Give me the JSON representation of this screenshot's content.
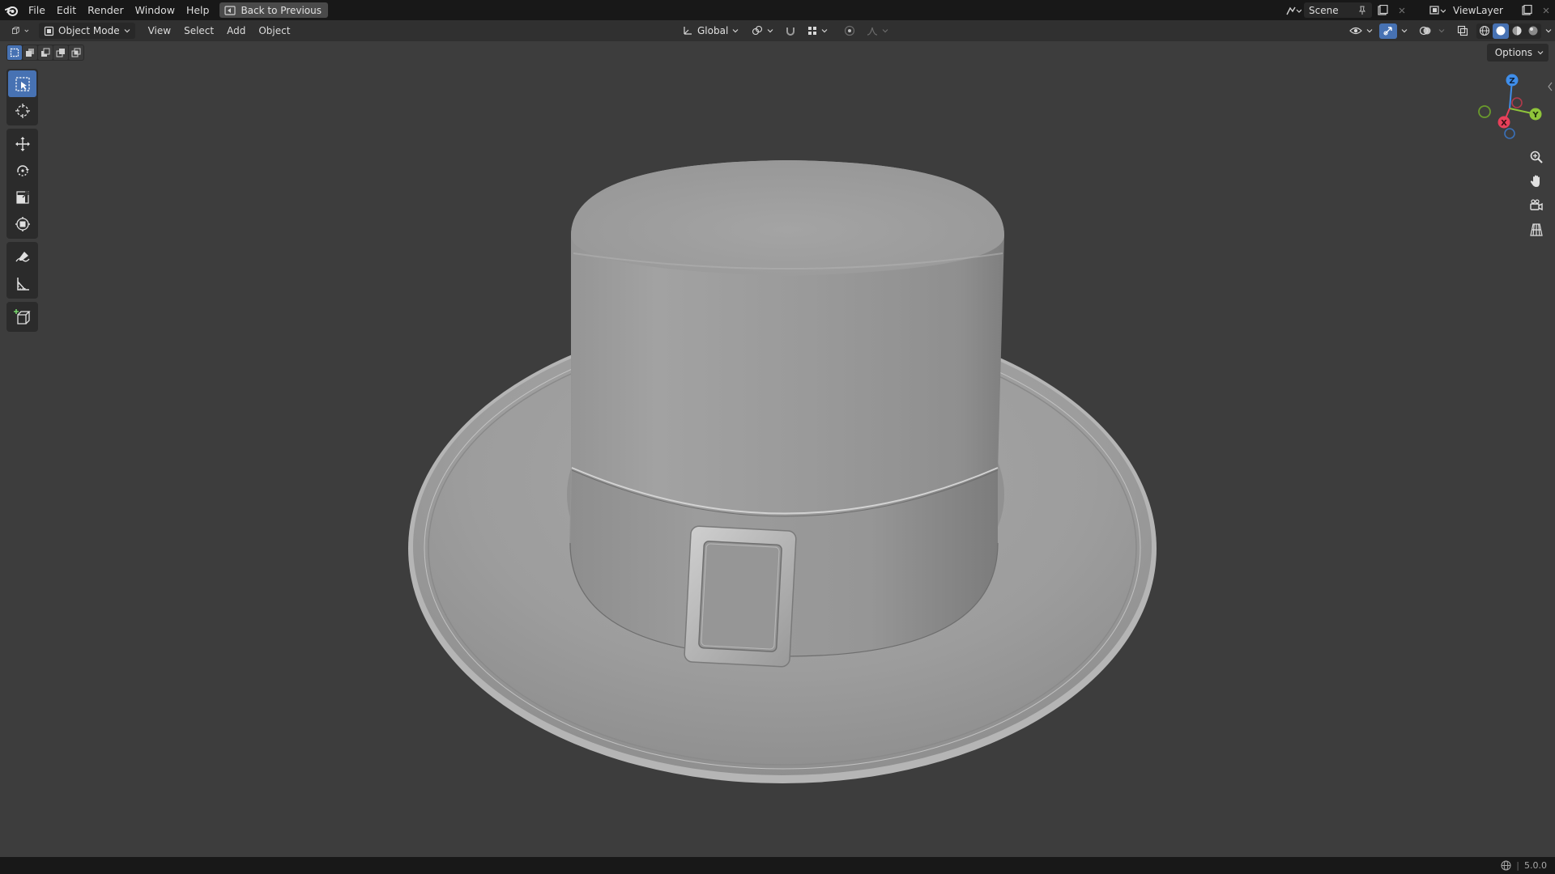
{
  "topbar": {
    "menus": [
      "File",
      "Edit",
      "Render",
      "Window",
      "Help"
    ],
    "back_button": "Back to Previous",
    "scene_name": "Scene",
    "view_layer": "ViewLayer"
  },
  "header": {
    "mode": "Object Mode",
    "menus": [
      "View",
      "Select",
      "Add",
      "Object"
    ],
    "transform_orientation": "Global"
  },
  "viewport": {
    "options_label": "Options",
    "gizmo": {
      "x": "X",
      "y": "Y",
      "z": "Z"
    },
    "colors": {
      "x": "#e8405a",
      "y": "#8fc53a",
      "z": "#3f8eea"
    }
  },
  "toolbar": {
    "tools": [
      "select-box-tool",
      "cursor-tool",
      "move-tool",
      "rotate-tool",
      "scale-tool",
      "transform-tool",
      "annotate-tool",
      "measure-tool",
      "add-cube-tool"
    ]
  },
  "statusbar": {
    "version": "5.0.0"
  },
  "theme": {
    "accent": "#4772b3"
  }
}
